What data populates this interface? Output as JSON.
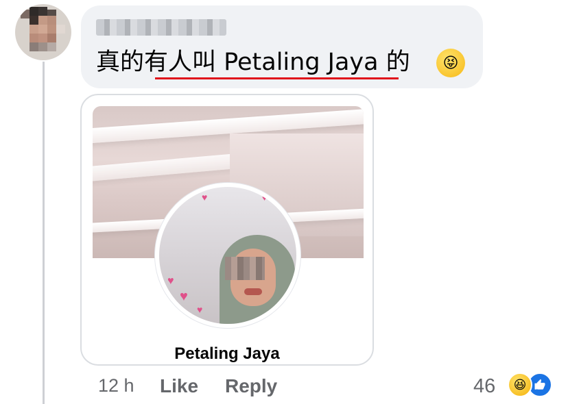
{
  "comment": {
    "text": "真的有人叫 Petaling Jaya 的",
    "emoji": "😝",
    "author_blurred": true
  },
  "link_card": {
    "profile_name": "Petaling Jaya"
  },
  "actions": {
    "time": "12 h",
    "like_label": "Like",
    "reply_label": "Reply"
  },
  "reactions": {
    "count": "46",
    "types": [
      "haha-icon",
      "like-icon"
    ]
  },
  "colors": {
    "bubble": "#f0f2f5",
    "meta_text": "#65676b",
    "underline": "#e0111b",
    "like_blue": "#1b74e4"
  }
}
